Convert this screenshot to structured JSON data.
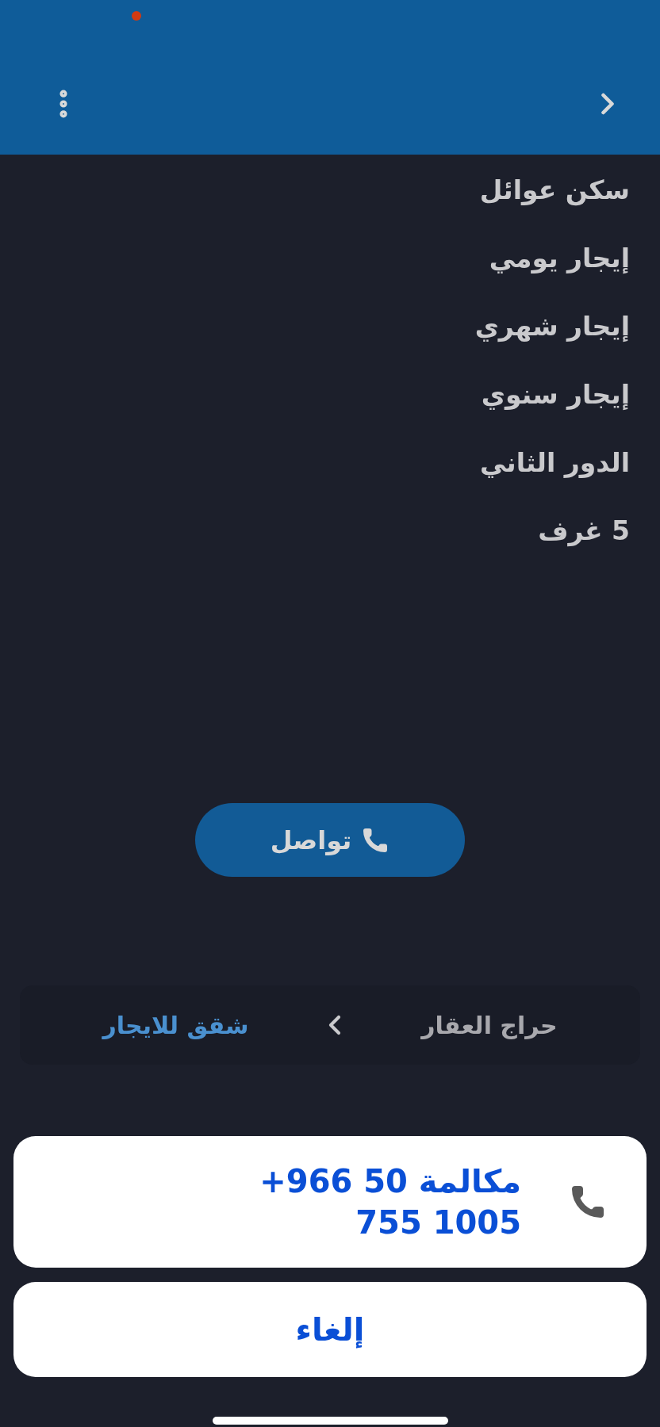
{
  "details": [
    "سكن عوائل",
    "إيجار يومي",
    "إيجار شهري",
    "إيجار سنوي",
    "الدور الثاني",
    "5 غرف"
  ],
  "contact_button": {
    "label": "تواصل"
  },
  "breadcrumb": [
    {
      "label": "حراج العقار",
      "kind": "parent"
    },
    {
      "label": "شقق للايجار",
      "kind": "link"
    }
  ],
  "action_sheet": {
    "call": "مكالمة",
    "phone": "+966 50 755 1005",
    "cancel": "إلغاء"
  }
}
